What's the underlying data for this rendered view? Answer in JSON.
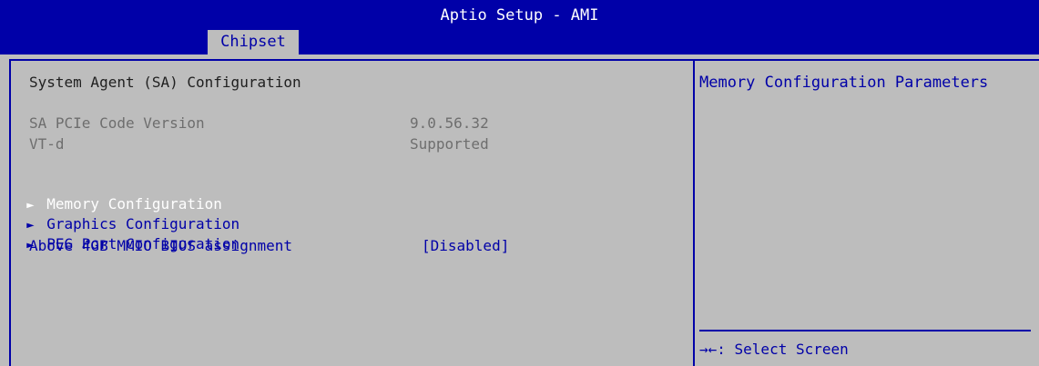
{
  "app": {
    "title": "Aptio Setup - AMI",
    "active_tab": "Chipset"
  },
  "main": {
    "section_title": "System Agent (SA) Configuration",
    "info": [
      {
        "label": "SA PCIe Code Version",
        "value": "9.0.56.32"
      },
      {
        "label": "VT-d",
        "value": "Supported"
      }
    ],
    "menu": [
      {
        "label": "Memory Configuration",
        "arrow": "►",
        "selected": true
      },
      {
        "label": "Graphics Configuration",
        "arrow": "►",
        "selected": false
      },
      {
        "label": "PEG Port Configuration",
        "arrow": "►",
        "selected": false
      }
    ],
    "option": {
      "label": "Above 4GB MMIO BIOS assignment",
      "value": "[Disabled]"
    }
  },
  "help_panel": {
    "description": "Memory Configuration Parameters",
    "hint": "→←: Select Screen"
  },
  "colors": {
    "background": "#bdbdbd",
    "header": "#0000a8",
    "selected_text": "#ffffff",
    "link_text": "#0000a8",
    "static_text": "#6e6e6e"
  }
}
